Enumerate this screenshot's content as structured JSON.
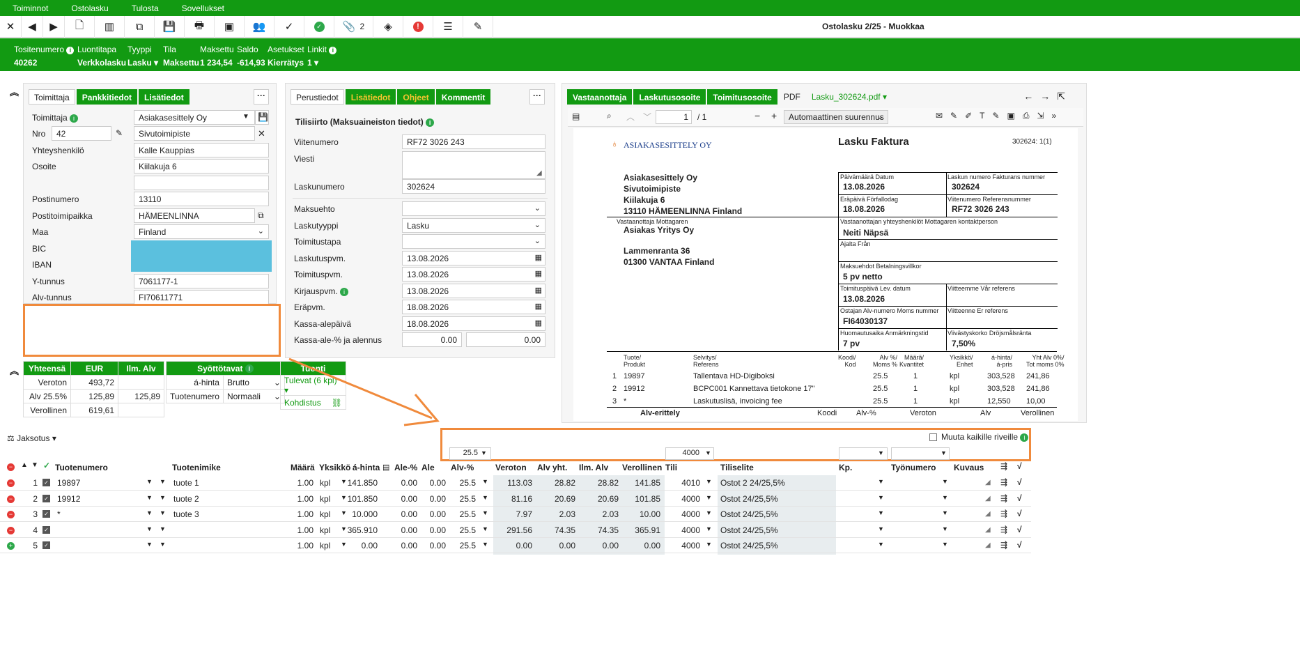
{
  "menu": {
    "items": [
      "Toiminnot",
      "Ostolasku",
      "Tulosta",
      "Sovellukset"
    ]
  },
  "toolbar": {
    "attach_count": "2"
  },
  "title": "Ostolasku 2/25 - Muokkaa",
  "info": {
    "tositenumero_l": "Tositenumero",
    "tositenumero_v": "40262",
    "luontitapa_l": "Luontitapa",
    "luontitapa_v": "Verkkolasku",
    "tyyppi_l": "Tyyppi",
    "tyyppi_v": "Lasku ▾",
    "tila_l": "Tila",
    "tila_v": "Maksettu",
    "maksettu_l": "Maksettu",
    "maksettu_v": "1 234,54",
    "saldo_l": "Saldo",
    "saldo_v": "-614,93",
    "asetukset_l": "Asetukset",
    "asetukset_v": "Kierrätys",
    "linkit_l": "Linkit",
    "linkit_v": "1 ▾"
  },
  "left": {
    "tabs": [
      "Toimittaja",
      "Pankkitiedot",
      "Lisätiedot"
    ],
    "labels": {
      "toimittaja": "Toimittaja",
      "nro": "Nro",
      "yhteys": "Yhteyshenkilö",
      "osoite": "Osoite",
      "postinumero": "Postinumero",
      "postitoimipaikka": "Postitoimipaikka",
      "maa": "Maa",
      "bic": "BIC",
      "iban": "IBAN",
      "ytunnus": "Y-tunnus",
      "alvtunnus": "Alv-tunnus"
    },
    "values": {
      "toimittaja": "Asiakasesittely Oy",
      "nro": "42",
      "nimi2": "Sivutoimipiste",
      "yhteys": "Kalle Kauppias",
      "osoite": "Kiilakuja 6",
      "osoite2": "",
      "postinumero": "13110",
      "postitoimipaikka": "HÄMEENLINNA",
      "maa": "Finland",
      "ytunnus": "7061177-1",
      "alvtunnus": "FI70611771"
    }
  },
  "middle": {
    "tabs": [
      "Perustiedot",
      "Lisätiedot",
      "Ohjeet",
      "Kommentit"
    ],
    "section": "Tilisiirto (Maksuaineiston tiedot)",
    "labels": {
      "viite": "Viitenumero",
      "viesti": "Viesti",
      "laskunumero": "Laskunumero",
      "maksuehto": "Maksuehto",
      "laskutyyppi": "Laskutyyppi",
      "toimitustapa": "Toimitustapa",
      "laskutuspvm": "Laskutuspvm.",
      "toimituspvm": "Toimituspvm.",
      "kirjauspvm": "Kirjauspvm.",
      "erapvm": "Eräpvm.",
      "kassapaiva": "Kassa-alepäivä",
      "kassaale": "Kassa-ale-% ja alennus"
    },
    "values": {
      "viite": "RF72 3026 243",
      "viesti": "",
      "laskunumero": "302624",
      "maksuehto": "",
      "laskutyyppi": "Lasku",
      "toimitustapa": "",
      "laskutuspvm": "13.08.2026",
      "toimituspvm": "13.08.2026",
      "kirjauspvm": "13.08.2026",
      "erapvm": "18.08.2026",
      "kassapaiva": "18.08.2026",
      "kassaale_pct": "0.00",
      "kassaale_amt": "0.00"
    }
  },
  "right": {
    "tabs": [
      "Vastaanottaja",
      "Laskutusosoite",
      "Toimitusosoite",
      "PDF"
    ],
    "pdf_file": "Lasku_302624.pdf ▾",
    "page_num": "1",
    "page_total": "/ 1",
    "zoom": "Automaattinen suurennus"
  },
  "pdf": {
    "brand": "ASIAKASESITTELY OY",
    "title": "Lasku Faktura",
    "pagenum": "302624:   1(1)",
    "sender": [
      "Asiakasesittely Oy",
      "Sivutoimipiste",
      "Kiilakuja 6",
      "13110 HÄMEENLINNA  Finland"
    ],
    "recv_label": "Vastaanottaja Mottagaren",
    "receiver": [
      "Asiakas Yritys Oy",
      "",
      "Lammenranta 36",
      "01300 VANTAA  Finland"
    ],
    "f_paiva_l": "Päivämäärä Datum",
    "f_paiva_v": "13.08.2026",
    "f_lnro_l": "Laskun numero Fakturans nummer",
    "f_lnro_v": "302624",
    "f_era_l": "Eräpäivä Förfallodag",
    "f_era_v": "18.08.2026",
    "f_viite_l": "Viitenumero Referensnummer",
    "f_viite_v": "RF72 3026 243",
    "f_yht_l": "Vastaanottajan yhteyshenkilöt Mottagaren kontaktperson",
    "f_yht_v": "Neiti Näpsä",
    "f_ajalta_l": "Ajalta Från",
    "f_ehto_l": "Maksuehdot Betalningsvillkor",
    "f_ehto_v": "5 pv netto",
    "f_toim_l": "Toimituspäivä Lev. datum",
    "f_toim_v": "13.08.2026",
    "f_vr_l": "Viitteemme Vår referens",
    "f_alv_l": "Ostajan Alv-numero Moms nummer",
    "f_alv_v": "FI64030137",
    "f_er_l": "Viitteenne Er referens",
    "f_huom_l": "Huomautusaika Anmärkningstid",
    "f_huom_v": "7 pv",
    "f_viiv_l": "Viivästyskorko Dröjsmålsränta",
    "f_viiv_v": "7,50%",
    "cols": [
      "Tuote/\nProdukt",
      "Selvitys/\nReferens",
      "Koodi/\nKod",
      "Alv %/\nMoms %",
      "Määrä/\nKvantitet",
      "Yksikkö/\nEnhet",
      "á-hinta/\ná-pris",
      "Yht Alv 0%/\nTot moms 0%"
    ],
    "rows": [
      [
        "1",
        "19897",
        "Tallentava HD-Digiboksi",
        "",
        "25.5",
        "1",
        "kpl",
        "303,528",
        "241,86"
      ],
      [
        "2",
        "19912",
        "BCPC001 Kannettava tietokone 17\"",
        "",
        "25.5",
        "1",
        "kpl",
        "303,528",
        "241,86"
      ],
      [
        "3",
        "*",
        "Laskutuslisä, invoicing fee",
        "",
        "25.5",
        "1",
        "kpl",
        "12,550",
        "10,00"
      ]
    ],
    "alv_header": [
      "Alv-erittely",
      "Koodi",
      "Alv-%",
      "Veroton",
      "Alv",
      "Verollinen"
    ]
  },
  "summary": {
    "head": [
      "Yhteensä",
      "EUR",
      "Ilm. Alv"
    ],
    "rows": [
      [
        "Veroton",
        "493,72",
        ""
      ],
      [
        "Alv 25.5%",
        "125,89",
        "125,89"
      ],
      [
        "Verollinen",
        "619,61",
        ""
      ]
    ]
  },
  "syotto": {
    "head": "Syöttötavat",
    "rows": [
      [
        "á-hinta",
        "Brutto"
      ],
      [
        "Tuotenumero",
        "Normaali"
      ]
    ]
  },
  "tuonti": {
    "head": "Tuonti",
    "rows": [
      "Tulevat (6 kpl)",
      "Kohdistus"
    ]
  },
  "jaksotus": "Jaksotus",
  "muuta": "Muuta kaikille riveille",
  "bulk": {
    "alv": "25.5",
    "tili": "4000"
  },
  "grid": {
    "headers": [
      "Tuotenumero",
      "Tuotenimike",
      "Määrä",
      "Yksikkö",
      "á-hinta",
      "Ale-%",
      "Ale",
      "Alv-%",
      "Veroton",
      "Alv yht.",
      "Ilm. Alv",
      "Verollinen",
      "Tili",
      "Tiliselite",
      "Kp.",
      "Työnumero",
      "Kuvaus"
    ],
    "rows": [
      [
        "1",
        "19897",
        "tuote 1",
        "1.00",
        "kpl",
        "141.850",
        "0.00",
        "0.00",
        "25.5",
        "113.03",
        "28.82",
        "28.82",
        "141.85",
        "4010",
        "Ostot 2 24/25,5%"
      ],
      [
        "2",
        "19912",
        "tuote 2",
        "1.00",
        "kpl",
        "101.850",
        "0.00",
        "0.00",
        "25.5",
        "81.16",
        "20.69",
        "20.69",
        "101.85",
        "4000",
        "Ostot 24/25,5%"
      ],
      [
        "3",
        "*",
        "tuote 3",
        "1.00",
        "kpl",
        "10.000",
        "0.00",
        "0.00",
        "25.5",
        "7.97",
        "2.03",
        "2.03",
        "10.00",
        "4000",
        "Ostot 24/25,5%"
      ],
      [
        "4",
        "",
        "",
        "1.00",
        "kpl",
        "365.910",
        "0.00",
        "0.00",
        "25.5",
        "291.56",
        "74.35",
        "74.35",
        "365.91",
        "4000",
        "Ostot 24/25,5%"
      ],
      [
        "5",
        "",
        "",
        "1.00",
        "kpl",
        "0.00",
        "0.00",
        "0.00",
        "25.5",
        "0.00",
        "0.00",
        "0.00",
        "0.00",
        "4000",
        "Ostot 24/25,5%"
      ]
    ]
  }
}
